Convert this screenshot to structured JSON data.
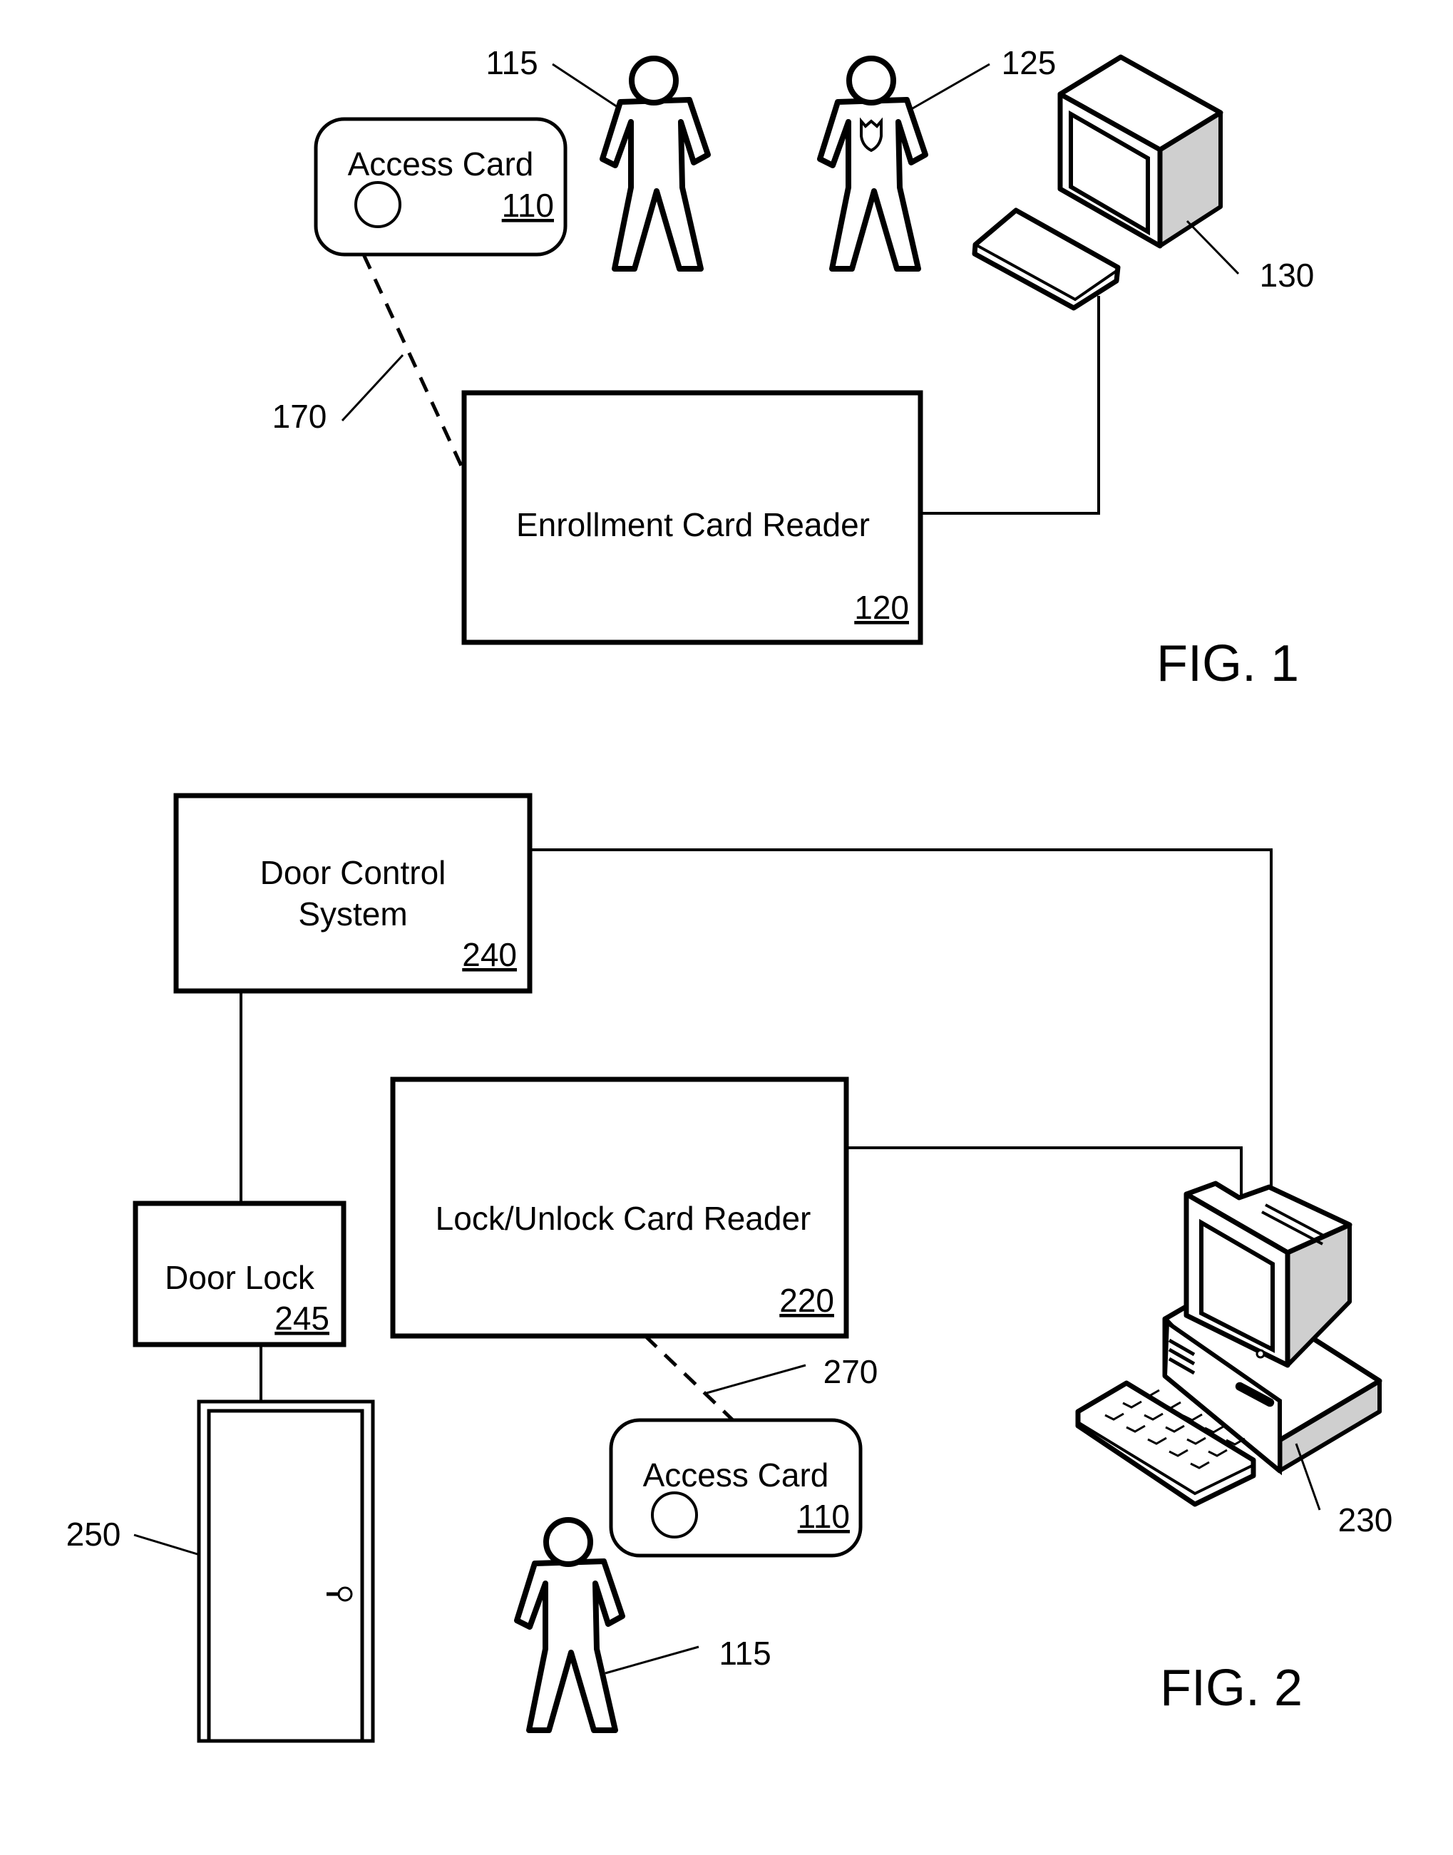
{
  "figures": {
    "fig1": {
      "caption": "FIG. 1",
      "access_card": {
        "title": "Access Card",
        "ref": "110"
      },
      "user_ref": "115",
      "admin_ref": "125",
      "computer_ref": "130",
      "link_ref": "170",
      "enrollment_reader": {
        "title": "Enrollment Card Reader",
        "ref": "120"
      }
    },
    "fig2": {
      "caption": "FIG. 2",
      "door_control": {
        "title_line1": "Door Control",
        "title_line2": "System",
        "ref": "240"
      },
      "door_lock": {
        "title": "Door Lock",
        "ref": "245"
      },
      "card_reader": {
        "title": "Lock/Unlock Card Reader",
        "ref": "220"
      },
      "access_card": {
        "title": "Access Card",
        "ref": "110"
      },
      "link_ref": "270",
      "door_ref": "250",
      "computer_ref": "230",
      "user_ref": "115"
    }
  }
}
